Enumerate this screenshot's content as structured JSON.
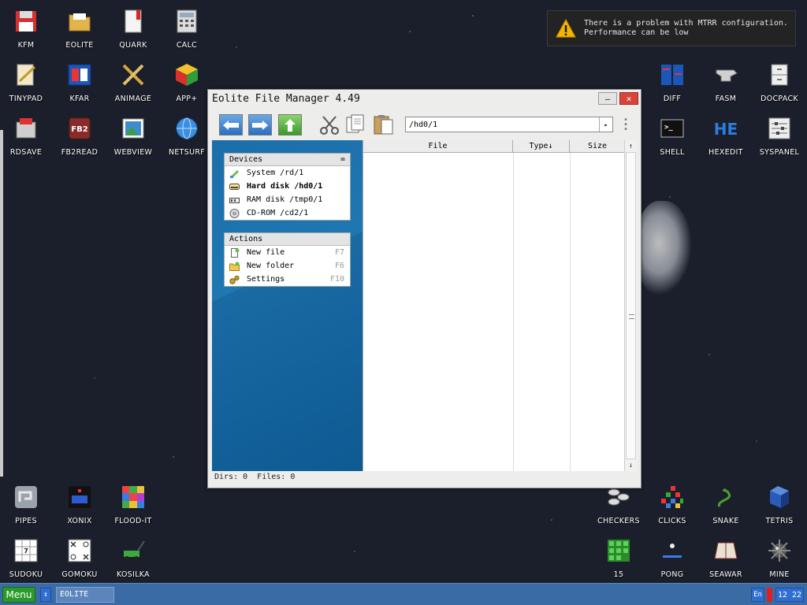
{
  "desktop": {
    "icons": [
      {
        "label": "KFM",
        "icon": "floppy-icon"
      },
      {
        "label": "EOLITE",
        "icon": "folder-icon"
      },
      {
        "label": "QUARK",
        "icon": "notebook-icon"
      },
      {
        "label": "CALC",
        "icon": "calculator-icon"
      },
      {
        "label": "TINYPAD",
        "icon": "notepad-icon"
      },
      {
        "label": "KFAR",
        "icon": "archive-icon"
      },
      {
        "label": "ANIMAGE",
        "icon": "brush-icon"
      },
      {
        "label": "APP+",
        "icon": "cube-icon"
      },
      {
        "label": "RDSAVE",
        "icon": "save-disk-icon"
      },
      {
        "label": "FB2READ",
        "icon": "book-icon"
      },
      {
        "label": "WEBVIEW",
        "icon": "picture-icon"
      },
      {
        "label": "NETSURF",
        "icon": "globe-icon"
      },
      {
        "label": "DIFF",
        "icon": "diff-icon"
      },
      {
        "label": "FASM",
        "icon": "anvil-icon"
      },
      {
        "label": "DOCPACK",
        "icon": "cabinet-icon"
      },
      {
        "label": "SHELL",
        "icon": "terminal-icon"
      },
      {
        "label": "HEXEDIT",
        "icon": "hex-icon"
      },
      {
        "label": "SYSPANEL",
        "icon": "sliders-icon"
      },
      {
        "label": "PIPES",
        "icon": "pipes-icon"
      },
      {
        "label": "XONIX",
        "icon": "xonix-icon"
      },
      {
        "label": "FLOOD-IT",
        "icon": "flood-icon"
      },
      {
        "label": "SUDOKU",
        "icon": "sudoku-icon"
      },
      {
        "label": "GOMOKU",
        "icon": "gomoku-icon"
      },
      {
        "label": "KOSILKA",
        "icon": "mower-icon"
      },
      {
        "label": "CHECKERS",
        "icon": "checkers-icon"
      },
      {
        "label": "CLICKS",
        "icon": "clicks-icon"
      },
      {
        "label": "SNAKE",
        "icon": "snake-icon"
      },
      {
        "label": "TETRIS",
        "icon": "tetris-icon"
      },
      {
        "label": "15",
        "icon": "fifteen-icon"
      },
      {
        "label": "PONG",
        "icon": "pong-icon"
      },
      {
        "label": "SEAWAR",
        "icon": "seawar-icon"
      },
      {
        "label": "MINE",
        "icon": "mine-icon"
      }
    ]
  },
  "notification": {
    "line1": "There is a problem with MTRR configuration.",
    "line2": "Performance can be low"
  },
  "window": {
    "title": "Eolite File Manager 4.49",
    "minimize": "–",
    "close": "×",
    "path": "/hd0/1",
    "go": "▸",
    "devices": {
      "header": "Devices",
      "toggle": "=",
      "items": [
        {
          "label": "System /rd/1",
          "bold": false
        },
        {
          "label": "Hard disk /hd0/1",
          "bold": true
        },
        {
          "label": "RAM disk /tmp0/1",
          "bold": false
        },
        {
          "label": "CD-ROM /cd2/1",
          "bold": false
        }
      ]
    },
    "actions": {
      "header": "Actions",
      "items": [
        {
          "label": "New file",
          "key": "F7"
        },
        {
          "label": "New folder",
          "key": "F6"
        },
        {
          "label": "Settings",
          "key": "F10"
        }
      ]
    },
    "columns": {
      "file": "File",
      "type": "Type↓",
      "size": "Size"
    },
    "scroll_up": "↑",
    "scroll_down": "↓",
    "status": "Dirs: 0  Files: 0"
  },
  "taskbar": {
    "menu": "Menu",
    "arrow": "↕",
    "task": "EOLITE",
    "lang": "En",
    "clock": "12 22"
  }
}
